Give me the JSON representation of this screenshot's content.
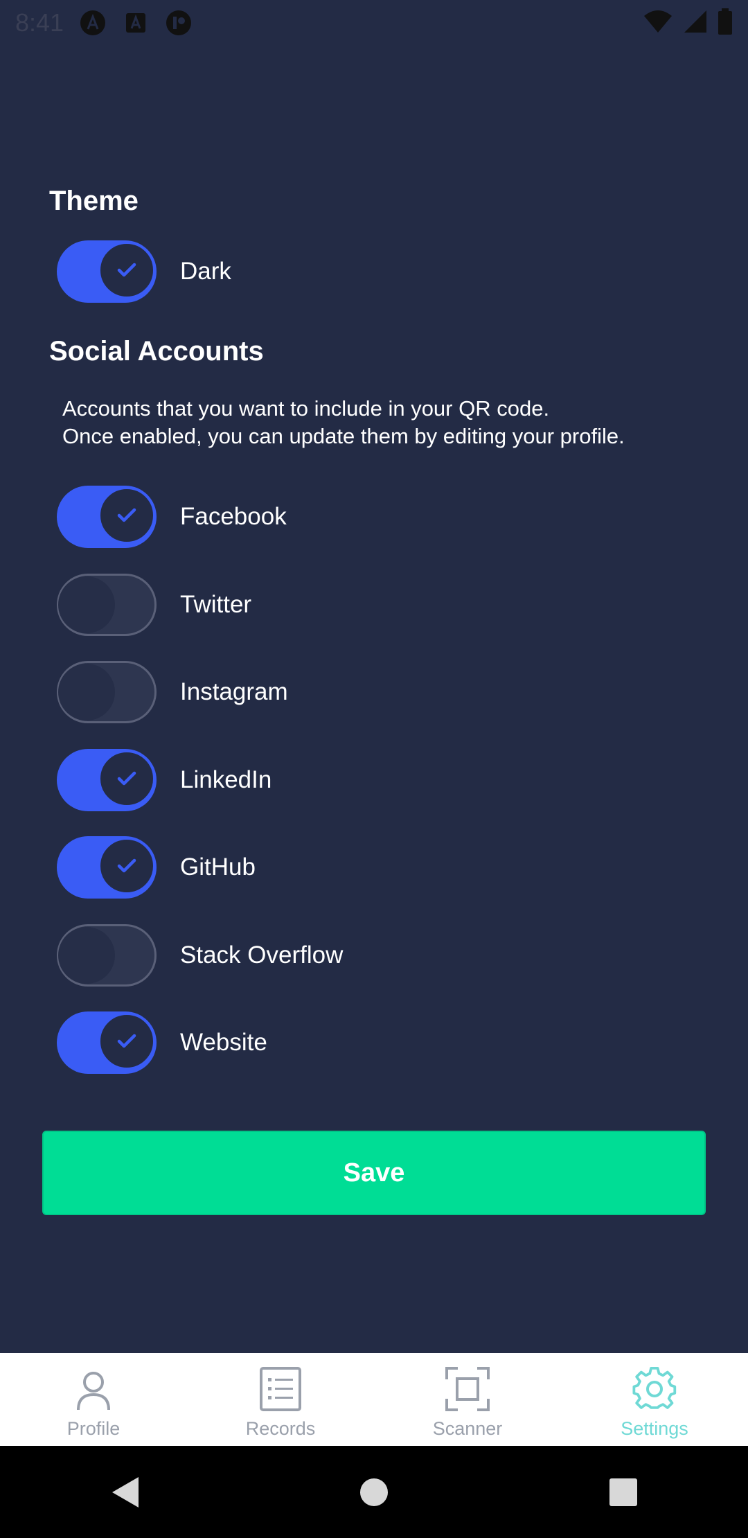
{
  "status_bar": {
    "time": "8:41",
    "left_icons": [
      "a-circle-icon",
      "a-square-icon",
      "r-circle-icon"
    ],
    "right_icons": [
      "wifi-icon",
      "signal-icon",
      "battery-icon"
    ]
  },
  "theme": {
    "title": "Theme",
    "toggle": {
      "label": "Dark",
      "on": true
    }
  },
  "social": {
    "title": "Social Accounts",
    "description_line1": "Accounts that you want to include in your QR code.",
    "description_line2": "Once enabled, you can update them by editing your profile.",
    "accounts": [
      {
        "label": "Facebook",
        "on": true
      },
      {
        "label": "Twitter",
        "on": false
      },
      {
        "label": "Instagram",
        "on": false
      },
      {
        "label": "LinkedIn",
        "on": true
      },
      {
        "label": "GitHub",
        "on": true
      },
      {
        "label": "Stack Overflow",
        "on": false
      },
      {
        "label": "Website",
        "on": true
      }
    ]
  },
  "save_label": "Save",
  "bottom_nav": {
    "items": [
      {
        "label": "Profile",
        "icon": "person-icon",
        "active": false
      },
      {
        "label": "Records",
        "icon": "list-icon",
        "active": false
      },
      {
        "label": "Scanner",
        "icon": "scanner-icon",
        "active": false
      },
      {
        "label": "Settings",
        "icon": "gear-icon",
        "active": true
      }
    ]
  },
  "colors": {
    "background": "#232b45",
    "toggle_on": "#3a5cf5",
    "save_button": "#00dd95",
    "nav_active": "#6fd9d5",
    "nav_inactive": "#9aa0ab"
  }
}
